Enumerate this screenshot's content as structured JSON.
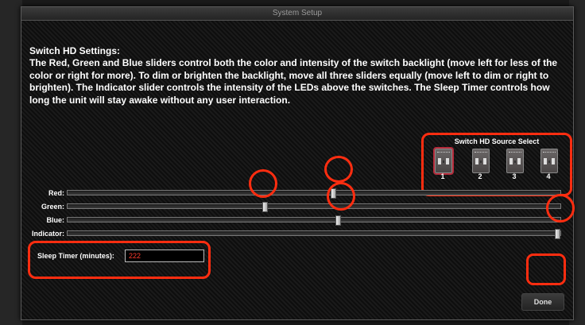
{
  "window": {
    "title": "System Setup"
  },
  "info": {
    "heading": "Switch HD Settings:",
    "body": "The Red, Green and Blue sliders control both the color and intensity of the switch backlight (move left for less of the color or right for more). To dim or brighten the backlight, move all three sliders equally (move left to dim or right to brighten). The Indicator slider controls the intensity of the LEDs above the switches. The Sleep Timer controls how long the unit will stay awake without any user interaction."
  },
  "source_select": {
    "title": "Switch HD Source Select",
    "selected": "1",
    "options": [
      {
        "number": "1",
        "icon": "dip-switch-icon"
      },
      {
        "number": "2",
        "icon": "dip-switch-icon"
      },
      {
        "number": "3",
        "icon": "dip-switch-icon"
      },
      {
        "number": "4",
        "icon": "dip-switch-icon"
      }
    ]
  },
  "sliders": [
    {
      "label": "Red:",
      "value_fraction": 0.54
    },
    {
      "label": "Green:",
      "value_fraction": 0.4
    },
    {
      "label": "Blue:",
      "value_fraction": 0.55
    },
    {
      "label": "Indicator:",
      "value_fraction": 1.0
    }
  ],
  "sleep_timer": {
    "label": "Sleep Timer (minutes):",
    "value": "222"
  },
  "buttons": {
    "done": "Done"
  },
  "colors": {
    "annotation": "#ff2d10",
    "selected_switch": "#b52a3a",
    "input_text": "#ff3b2e"
  }
}
